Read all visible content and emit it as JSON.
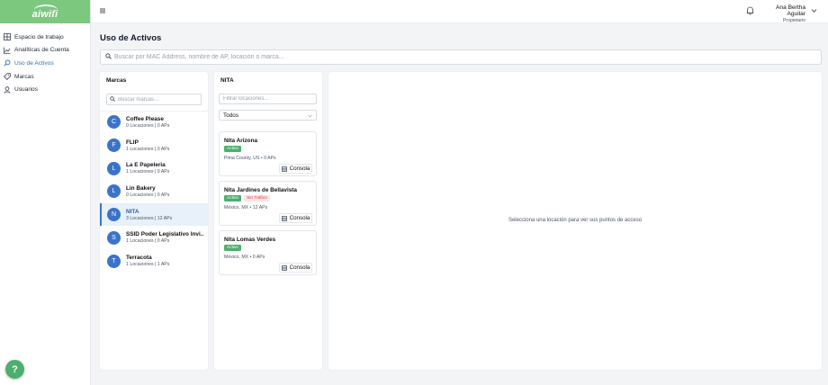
{
  "app": {
    "logo_text": "aiwifi"
  },
  "sidebar": {
    "items": [
      {
        "label": "Espacio de trabajo",
        "icon": "workspace-icon",
        "active": false
      },
      {
        "label": "Analíticas de Cuenta",
        "icon": "analytics-icon",
        "active": false
      },
      {
        "label": "Uso de Activos",
        "icon": "search-icon",
        "active": true
      },
      {
        "label": "Marcas",
        "icon": "tag-icon",
        "active": false
      },
      {
        "label": "Usuarios",
        "icon": "user-icon",
        "active": false
      }
    ],
    "help_label": "?"
  },
  "header": {
    "user_name": "Ana Bertha Aguilar",
    "user_role": "Propietario"
  },
  "page": {
    "title": "Uso de Activos",
    "search_placeholder": "Buscar por MAC Address, nombre de AP, locación o marca..."
  },
  "brands_panel": {
    "title": "Marcas",
    "search_placeholder": "Buscar marcas...",
    "items": [
      {
        "initial": "C",
        "name": "Coffee Please",
        "meta": "0 Locaciones | 0 APs",
        "active": false
      },
      {
        "initial": "F",
        "name": "FLIP",
        "meta": "1 Locaciones | 0 APs",
        "active": false
      },
      {
        "initial": "L",
        "name": "La E Papeleria",
        "meta": "1 Locaciones | 0 APs",
        "active": false
      },
      {
        "initial": "L",
        "name": "Lin Bakery",
        "meta": "0 Locaciones | 0 APs",
        "active": false
      },
      {
        "initial": "N",
        "name": "NITA",
        "meta": "3 Locaciones | 12 APs",
        "active": true
      },
      {
        "initial": "S",
        "name": "SSID Poder Legislativo Invi...",
        "meta": "1 Locaciones | 0 APs",
        "active": false
      },
      {
        "initial": "T",
        "name": "Terracota",
        "meta": "1 Locaciones | 1 APs",
        "active": false
      }
    ]
  },
  "locations_panel": {
    "title": "NITA",
    "filter_placeholder": "Filtrar locaciones...",
    "select_value": "Todos",
    "console_label": "Consola",
    "items": [
      {
        "name": "Nita Arizona",
        "badges": [
          "Activo"
        ],
        "meta": "Pima County, US • 0 APs"
      },
      {
        "name": "Nita Jardines de Bellavista",
        "badges": [
          "Activo",
          "Sin Tráfico"
        ],
        "meta": "México, MX • 12 APs"
      },
      {
        "name": "Nita Lomas Verdes",
        "badges": [
          "Activo"
        ],
        "meta": "México, MX • 0 APs"
      }
    ]
  },
  "detail_panel": {
    "empty_message": "Selecciona una locación para ver sus puntos de acceso"
  },
  "colors": {
    "brand_green": "#7cc87e",
    "accent_blue": "#3b73c9",
    "status_active": "#4caf6e",
    "status_warning": "#d14343"
  }
}
